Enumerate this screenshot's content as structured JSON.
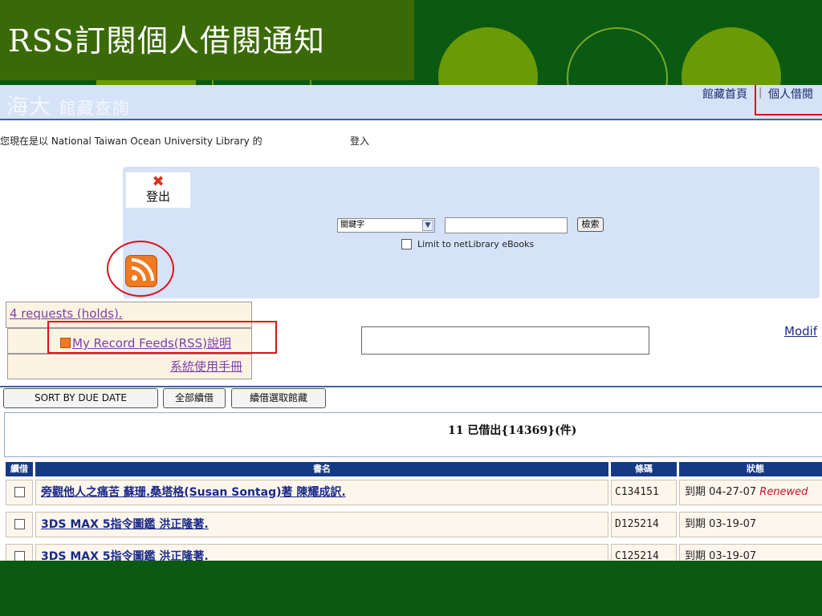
{
  "slide": {
    "title": "RSS訂閱個人借閱通知"
  },
  "header": {
    "logo_main": "海大",
    "logo_sub": "館藏查詢",
    "link_home": "館藏首頁",
    "link_personal": "個人借閱"
  },
  "login": {
    "status_text": "您現在是以 National Taiwan Ocean University Library 的",
    "login_label": "登入"
  },
  "search": {
    "logout_label": "登出",
    "field_select": "關鍵字",
    "search_button": "檢索",
    "ebooks_label": "Limit to netLibrary eBooks"
  },
  "links": {
    "holds": "4 requests (holds).",
    "feeds": "My Record Feeds(RSS)",
    "feeds_help": "說明",
    "manual": "系統使用手冊",
    "modify": "Modif"
  },
  "actions": {
    "sort": "SORT BY DUE DATE",
    "renew_all": "全部續借",
    "renew_selected": "續借選取館藏"
  },
  "summary": "11 已借出{14369}(件)",
  "table": {
    "headers": [
      "續借",
      "書名",
      "條碼",
      "狀態"
    ],
    "rows": [
      {
        "title": "旁觀他人之痛苦 蘇珊.桑塔格(Susan Sontag)著 陳耀成訳.",
        "barcode": "C134151",
        "due": "到期 04-27-07",
        "note": "Renewed"
      },
      {
        "title": "3DS MAX 5指令圖鑑 洪正隆著.",
        "barcode": "D125214",
        "due": "到期 03-19-07",
        "note": ""
      },
      {
        "title": "3DS MAX 5指令圖鑑 洪正隆著.",
        "barcode": "C125214",
        "due": "到期 03-19-07",
        "note": ""
      }
    ]
  },
  "colors": {
    "slide_bg": "#0b5a12",
    "title_box": "#3a6a07",
    "accent_circle": "#6a9a06",
    "header_blue": "#153a85",
    "highlight_red": "#e0101a",
    "rss_orange": "#f07a21"
  },
  "icons": {
    "logout": "close-x-icon",
    "rss": "rss-feed-icon"
  }
}
